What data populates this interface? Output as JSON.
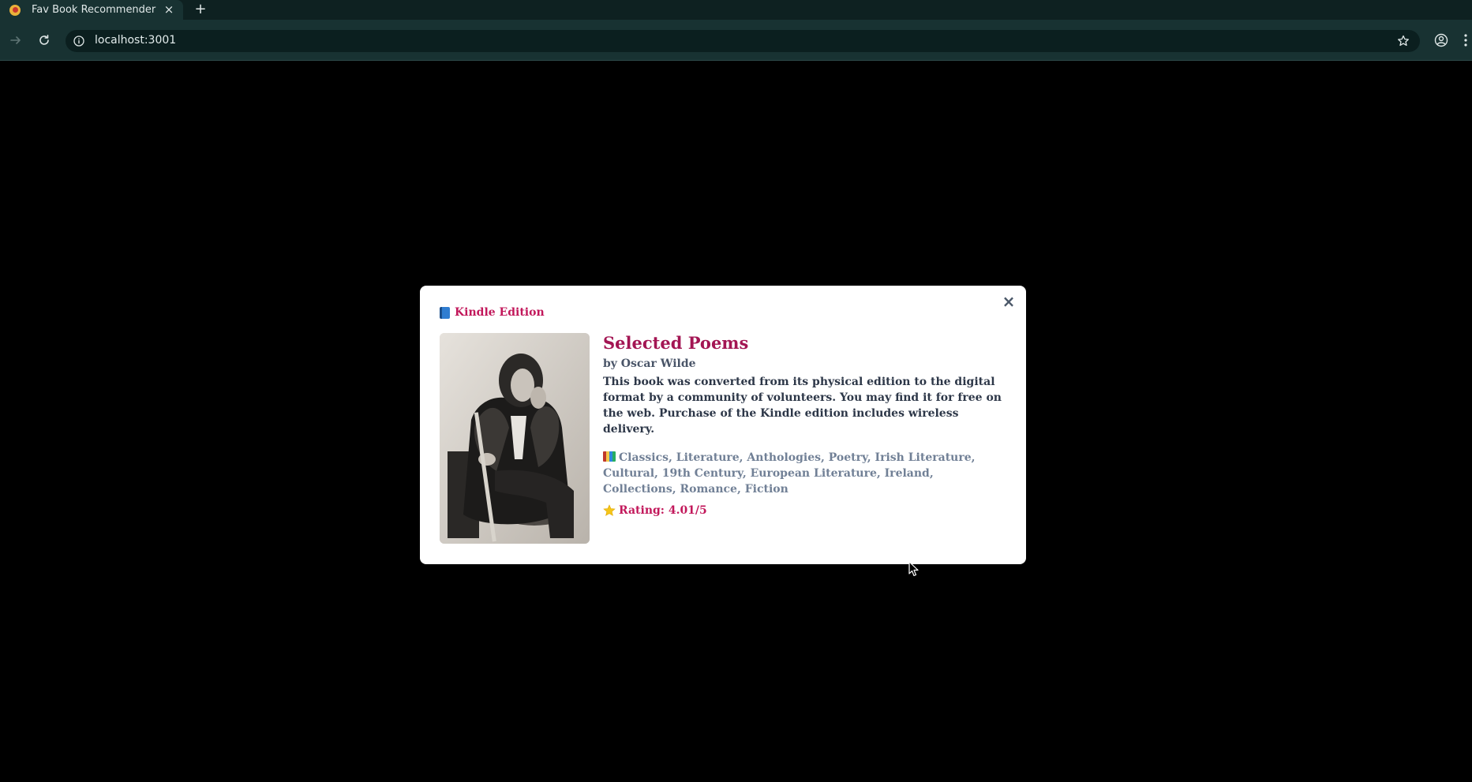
{
  "browser": {
    "tab": {
      "title": "Fav Book Recommender",
      "close_glyph": "×",
      "favicon": "book-favicon"
    },
    "new_tab_glyph": "+",
    "address_bar": {
      "url": "localhost:3001",
      "info_icon": "info-icon",
      "bookmark_icon": "star-outline-icon"
    },
    "nav": {
      "forward_icon": "arrow-right-icon",
      "reload_icon": "reload-icon"
    },
    "profile_icon": "profile-icon",
    "menu_icon": "kebab-menu-icon"
  },
  "modal": {
    "close_glyph": "×",
    "edition": {
      "icon": "blue-book-icon",
      "label": "Kindle Edition"
    },
    "cover": {
      "alt": "Book cover portrait of Oscar Wilde"
    },
    "title": "Selected Poems",
    "author": "by Oscar Wilde",
    "description": "This book was converted from its physical edition to the digital format by a community of volunteers. You may find it for free on the web. Purchase of the Kindle edition includes wireless delivery.",
    "genres": {
      "icon": "books-icon",
      "text": "Classics, Literature, Anthologies, Poetry, Irish Literature, Cultural, 19th Century, European Literature, Ireland, Collections, Romance, Fiction"
    },
    "rating": {
      "icon": "star-icon",
      "text": "Rating: 4.01/5",
      "value": 4.01,
      "max": 5
    }
  },
  "colors": {
    "accent": "#c2185b",
    "title": "#a31553",
    "chrome_bg": "#183232",
    "tabstrip_bg": "#0e2121",
    "page_bg": "#000000"
  }
}
